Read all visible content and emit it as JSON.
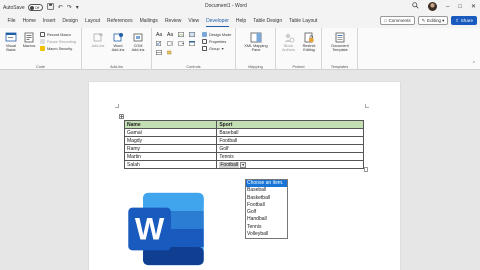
{
  "titlebar": {
    "autosave_label": "AutoSave",
    "autosave_state": "Off",
    "document_title": "Document1 - Word"
  },
  "tabs": [
    {
      "label": "File",
      "active": false
    },
    {
      "label": "Home",
      "active": false
    },
    {
      "label": "Insert",
      "active": false
    },
    {
      "label": "Design",
      "active": false
    },
    {
      "label": "Layout",
      "active": false
    },
    {
      "label": "References",
      "active": false
    },
    {
      "label": "Mailings",
      "active": false
    },
    {
      "label": "Review",
      "active": false
    },
    {
      "label": "View",
      "active": false
    },
    {
      "label": "Developer",
      "active": true
    },
    {
      "label": "Help",
      "active": false
    },
    {
      "label": "Table Design",
      "active": false
    },
    {
      "label": "Table Layout",
      "active": false
    }
  ],
  "tab_right": {
    "comments_label": "Comments",
    "editing_label": "Editing",
    "share_label": "Share"
  },
  "ribbon": {
    "code": {
      "label": "Code",
      "visual_basic": "Visual Basic",
      "macros": "Macros",
      "record_macro": "Record Macro",
      "pause_recording": "Pause Recording",
      "macro_security": "Macro Security"
    },
    "addins": {
      "label": "Add-ins",
      "add_ins": "Add-ins",
      "word_addins": "Word Add-ins",
      "com_addins": "COM Add-ins"
    },
    "controls": {
      "label": "Controls",
      "design_mode": "Design Mode",
      "properties": "Properties",
      "group": "Group"
    },
    "mapping": {
      "label": "Mapping",
      "xml_mapping_pane": "XML Mapping Pane"
    },
    "protect": {
      "label": "Protect",
      "block_authors": "Block Authors",
      "restrict_editing": "Restrict Editing"
    },
    "templates": {
      "label": "Templates",
      "document_template": "Document Template"
    }
  },
  "table": {
    "headers": [
      "Name",
      "Sport"
    ],
    "header_color": "#c5dfb4",
    "rows": [
      [
        "Gamal",
        "Baseball"
      ],
      [
        "Magdy",
        "Football"
      ],
      [
        "Ramy",
        "Golf"
      ],
      [
        "Martin",
        "Tennis"
      ],
      [
        "Salah",
        "Football"
      ]
    ]
  },
  "dropdown": {
    "options": [
      "Choose an item.",
      "Baseball",
      "Basketball",
      "Football",
      "Golf",
      "Handball",
      "Tennis",
      "Volleyball"
    ],
    "highlighted_index": 0,
    "highlight_color": "#1874d6"
  },
  "colors": {
    "accent": "#1f5fa8",
    "word_blue_dark": "#185abd",
    "word_blue_light": "#41a5ee"
  },
  "logo": {
    "letter": "W"
  }
}
